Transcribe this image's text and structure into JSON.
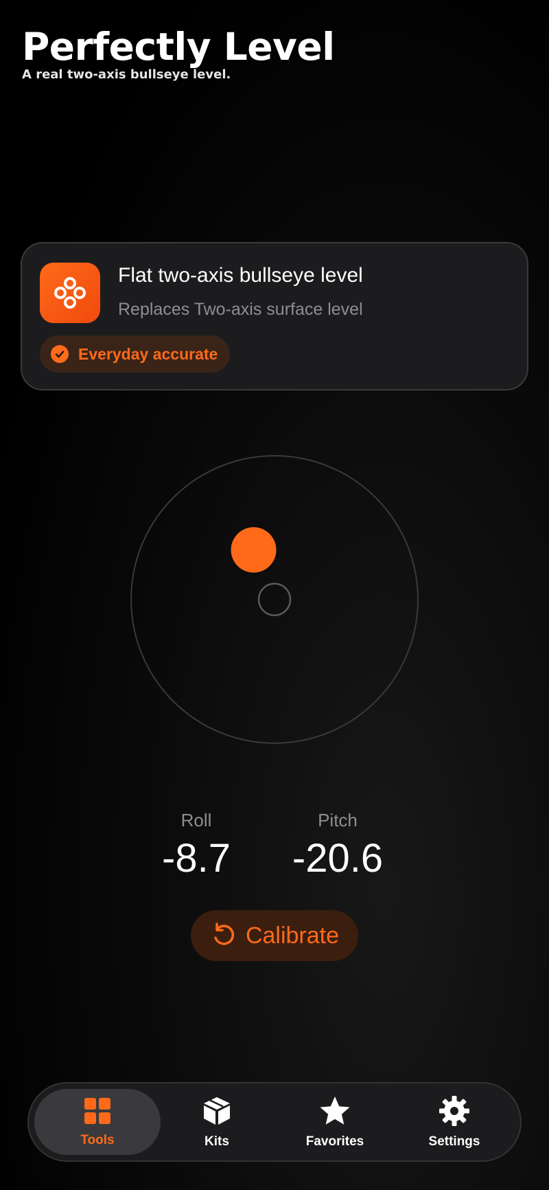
{
  "header": {
    "title": "Perfectly Level",
    "subtitle": "A real two-axis bullseye level."
  },
  "tool_card": {
    "icon": "bullseye-dots-icon",
    "title": "Flat two-axis bullseye level",
    "subtitle": "Replaces Two-axis surface level",
    "badge": {
      "icon": "checkmark-circle-icon",
      "label": "Everyday accurate"
    }
  },
  "level": {
    "roll_degrees": -8.7,
    "pitch_degrees": -20.6
  },
  "readouts": {
    "roll_label": "Roll",
    "roll_value": "-8.7",
    "pitch_label": "Pitch",
    "pitch_value": "-20.6"
  },
  "calibrate": {
    "icon": "rotate-ccw-icon",
    "label": "Calibrate"
  },
  "tabs": [
    {
      "label": "Tools",
      "icon": "grid-icon",
      "active": true
    },
    {
      "label": "Kits",
      "icon": "box-icon",
      "active": false
    },
    {
      "label": "Favorites",
      "icon": "star-icon",
      "active": false
    },
    {
      "label": "Settings",
      "icon": "gear-icon",
      "active": false
    }
  ],
  "colors": {
    "accent": "#ff6a1a",
    "background": "#000000",
    "card": "#1c1c1e",
    "secondary_text": "#8e8e93"
  }
}
